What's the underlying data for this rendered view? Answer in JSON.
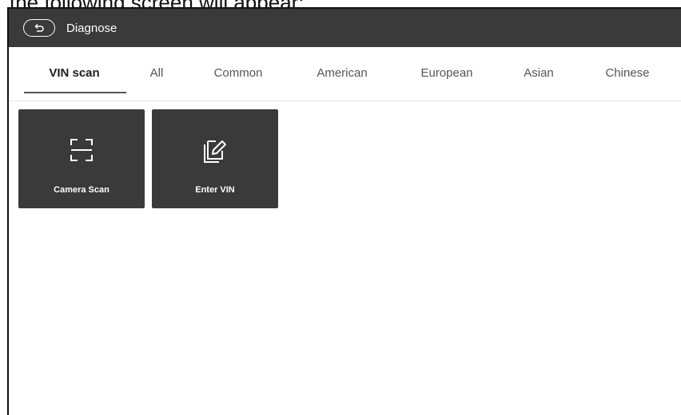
{
  "caption": {
    "text": "the following screen will appear:"
  },
  "header": {
    "back_icon": "back-return-icon",
    "title": "Diagnose"
  },
  "tabs": [
    {
      "label": "VIN scan",
      "active": true
    },
    {
      "label": "All",
      "active": false
    },
    {
      "label": "Common",
      "active": false
    },
    {
      "label": "American",
      "active": false
    },
    {
      "label": "European",
      "active": false
    },
    {
      "label": "Asian",
      "active": false
    },
    {
      "label": "Chinese",
      "active": false
    }
  ],
  "tiles": [
    {
      "label": "Camera Scan",
      "icon": "scan-frame-icon"
    },
    {
      "label": "Enter VIN",
      "icon": "edit-note-icon"
    }
  ],
  "colors": {
    "topbar": "#3a3a3a",
    "tile": "#3a3a3a",
    "background": "#ffffff"
  }
}
